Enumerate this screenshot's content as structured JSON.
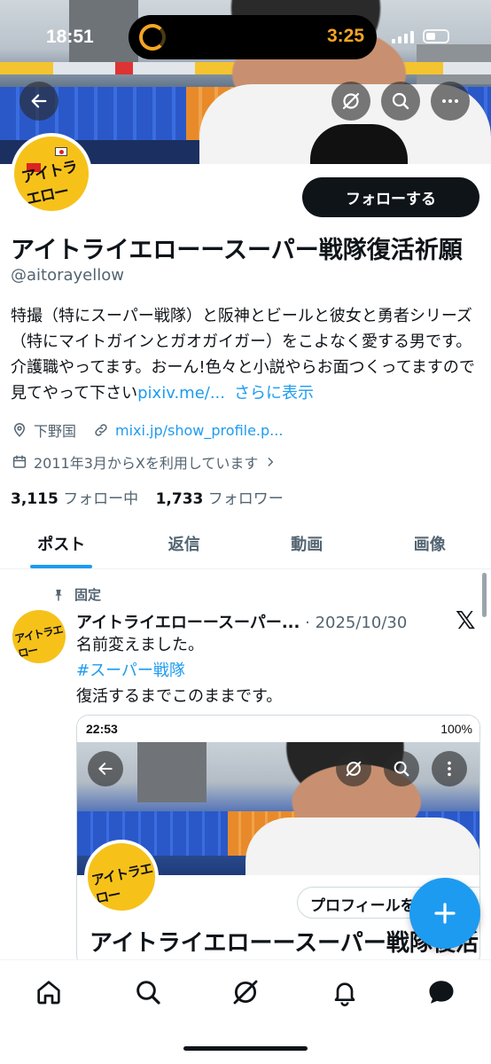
{
  "status_bar": {
    "time": "18:51",
    "island_timer": "3:25",
    "accent_color": "#f5a524"
  },
  "header": {
    "back_icon": "arrow-left-icon",
    "grok_icon": "grok-icon",
    "search_icon": "search-icon",
    "more_icon": "more-horizontal-icon"
  },
  "profile": {
    "display_name": "アイトライエローースーパー戦隊復活祈願",
    "handle": "@aitorayellow",
    "follow_label": "フォローする",
    "avatar_text": "アイトラエロー",
    "bio_text": "特撮（特にスーパー戦隊）と阪神とビールと彼女と勇者シリーズ（特にマイトガインとガオガイガー）をこよなく愛する男です。介護職やってます。おーん!色々と小説やらお面つくってますので見てやって下さい",
    "bio_link": "pixiv.me/...",
    "bio_more": "さらに表示",
    "location": "下野国",
    "website": "mixi.jp/show_profile.p...",
    "joined": "2011年3月からXを利用しています",
    "following_count": "3,115",
    "following_label": "フォロー中",
    "followers_count": "1,733",
    "followers_label": "フォロワー"
  },
  "tabs": [
    {
      "label": "ポスト",
      "active": true
    },
    {
      "label": "返信",
      "active": false
    },
    {
      "label": "動画",
      "active": false
    },
    {
      "label": "画像",
      "active": false
    }
  ],
  "pinned_post": {
    "pinned_label": "固定",
    "author": "アイトライエローースーパー...",
    "separator": "·",
    "date": "2025/10/30",
    "line1": "名前変えました。",
    "hashtag": "#スーパー戦隊",
    "line3": "復活するまでこのままです。",
    "embed": {
      "time": "22:53",
      "battery": "100%",
      "profile_button": "プロフィールを",
      "name": "アイトライエローースーパー戦隊復活"
    }
  },
  "colors": {
    "accent": "#1d9bf0",
    "text_primary": "#0f1419",
    "text_secondary": "#536471"
  },
  "bottom_nav": [
    {
      "name": "home",
      "icon": "home-icon"
    },
    {
      "name": "search",
      "icon": "search-icon"
    },
    {
      "name": "grok",
      "icon": "grok-icon"
    },
    {
      "name": "notifications",
      "icon": "bell-icon"
    },
    {
      "name": "messages",
      "icon": "chat-bubble-icon"
    }
  ]
}
